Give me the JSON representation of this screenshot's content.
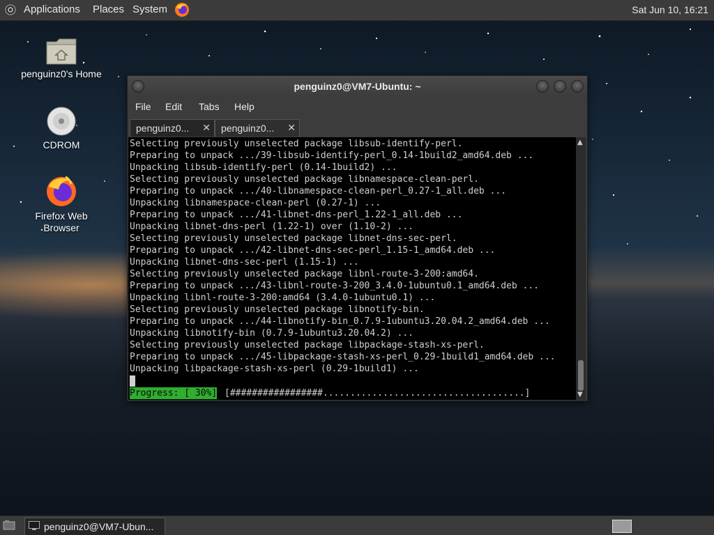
{
  "top_panel": {
    "menus": [
      "Applications",
      "Places",
      "System"
    ],
    "clock": "Sat Jun 10, 16:21"
  },
  "desktop_icons": {
    "home": "penguinz0's Home",
    "cdrom": "CDROM",
    "firefox": "Firefox Web Browser"
  },
  "window": {
    "title": "penguinz0@VM7-Ubuntu: ~",
    "menu": [
      "File",
      "Edit",
      "Tabs",
      "Help"
    ],
    "tabs": [
      {
        "label": "penguinz0...",
        "close": "✕"
      },
      {
        "label": "penguinz0...",
        "close": "✕"
      }
    ]
  },
  "terminal": {
    "lines": [
      "Selecting previously unselected package libsub-identify-perl.",
      "Preparing to unpack .../39-libsub-identify-perl_0.14-1build2_amd64.deb ...",
      "Unpacking libsub-identify-perl (0.14-1build2) ...",
      "Selecting previously unselected package libnamespace-clean-perl.",
      "Preparing to unpack .../40-libnamespace-clean-perl_0.27-1_all.deb ...",
      "Unpacking libnamespace-clean-perl (0.27-1) ...",
      "Preparing to unpack .../41-libnet-dns-perl_1.22-1_all.deb ...",
      "Unpacking libnet-dns-perl (1.22-1) over (1.10-2) ...",
      "Selecting previously unselected package libnet-dns-sec-perl.",
      "Preparing to unpack .../42-libnet-dns-sec-perl_1.15-1_amd64.deb ...",
      "Unpacking libnet-dns-sec-perl (1.15-1) ...",
      "Selecting previously unselected package libnl-route-3-200:amd64.",
      "Preparing to unpack .../43-libnl-route-3-200_3.4.0-1ubuntu0.1_amd64.deb ...",
      "Unpacking libnl-route-3-200:amd64 (3.4.0-1ubuntu0.1) ...",
      "Selecting previously unselected package libnotify-bin.",
      "Preparing to unpack .../44-libnotify-bin_0.7.9-1ubuntu3.20.04.2_amd64.deb ...",
      "Unpacking libnotify-bin (0.7.9-1ubuntu3.20.04.2) ...",
      "Selecting previously unselected package libpackage-stash-xs-perl.",
      "Preparing to unpack .../45-libpackage-stash-xs-perl_0.29-1build1_amd64.deb ...",
      "Unpacking libpackage-stash-xs-perl (0.29-1build1) ..."
    ],
    "progress_label": "Progress: [ 30%]",
    "progress_bar": "[#################.....................................]",
    "progress_percent": 30
  },
  "taskbar": {
    "task_label": "penguinz0@VM7-Ubun..."
  },
  "colors": {
    "progress_green": "#2fae2f",
    "panel": "#3b3b3b",
    "terminal_bg": "#000000"
  }
}
